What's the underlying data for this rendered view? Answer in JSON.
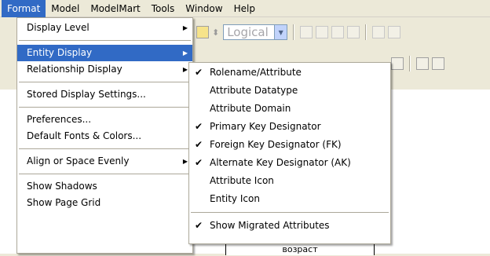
{
  "menubar": {
    "items": [
      {
        "label": "Format",
        "active": true
      },
      {
        "label": "Model",
        "active": false
      },
      {
        "label": "ModelMart",
        "active": false
      },
      {
        "label": "Tools",
        "active": false
      },
      {
        "label": "Window",
        "active": false
      },
      {
        "label": "Help",
        "active": false
      }
    ]
  },
  "toolbar": {
    "view_combo_value": "Logical"
  },
  "canvas": {
    "entity_attribute_text": "возраст"
  },
  "format_menu": {
    "items": [
      {
        "label": "Display Level",
        "submenu": true
      },
      {
        "separator": true
      },
      {
        "label": "Entity Display",
        "submenu": true,
        "highlighted": true
      },
      {
        "label": "Relationship Display",
        "submenu": true
      },
      {
        "separator": true
      },
      {
        "label": "Stored Display Settings..."
      },
      {
        "separator": true
      },
      {
        "label": "Preferences..."
      },
      {
        "label": "Default Fonts & Colors..."
      },
      {
        "separator": true
      },
      {
        "label": "Align or Space Evenly",
        "submenu": true
      },
      {
        "separator": true
      },
      {
        "label": "Show Shadows"
      },
      {
        "label": "Show Page Grid"
      }
    ]
  },
  "entity_display_submenu": {
    "items": [
      {
        "label": "Rolename/Attribute",
        "checked": true
      },
      {
        "label": "Attribute Datatype",
        "checked": false
      },
      {
        "label": "Attribute Domain",
        "checked": false
      },
      {
        "label": "Primary Key Designator",
        "checked": true
      },
      {
        "label": "Foreign Key Designator (FK)",
        "checked": true
      },
      {
        "label": "Alternate Key Designator (AK)",
        "checked": true
      },
      {
        "label": "Attribute Icon",
        "checked": false
      },
      {
        "label": "Entity Icon",
        "checked": false
      },
      {
        "separator": true
      },
      {
        "label": "Show Migrated Attributes",
        "checked": true
      }
    ]
  },
  "glyphs": {
    "check": "✔",
    "submenu_arrow": "▶",
    "combo_arrow": "▼"
  },
  "colors": {
    "highlight": "#316AC5",
    "menu_bg": "#FFFFFF",
    "chrome_bg": "#ECE9D8"
  }
}
